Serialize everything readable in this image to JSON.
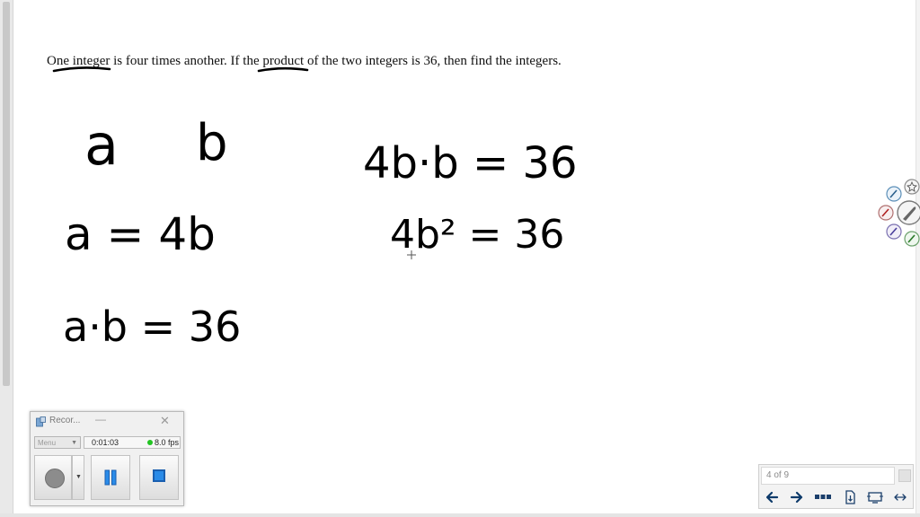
{
  "problem": {
    "part1": "One integer",
    "part2": " is four times another. If ",
    "part3": "the product",
    "part4": " of the two integers is 36, then find the integers."
  },
  "handwriting": {
    "var_a": "a",
    "var_b": "b",
    "eq1": "a = 4b",
    "eq2": "a·b = 36",
    "eq3": "4b·b = 36",
    "eq4": "4b² = 36"
  },
  "recorder": {
    "title": "Recor...",
    "minimize_glyph": "—",
    "close_glyph": "✕",
    "menu_label": "Menu",
    "elapsed": "0:01:03",
    "fps": "8.0 fps",
    "status_color": "#22c422",
    "stop_color": "#2a8be8"
  },
  "pagenav": {
    "page_indicator": "4 of 9"
  },
  "colors": {
    "ink": "#000000",
    "background": "#ffffff"
  }
}
